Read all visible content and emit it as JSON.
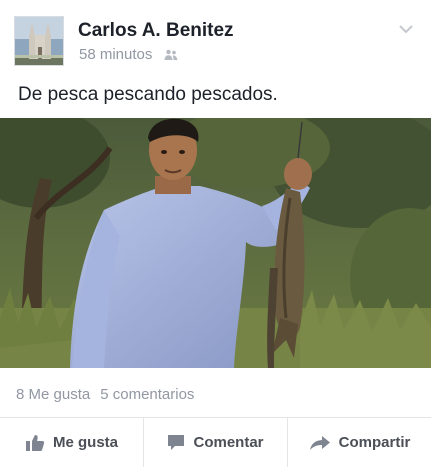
{
  "post": {
    "author": "Carlos A. Benitez",
    "time": "58 minutos",
    "audience_icon": "friends-icon",
    "menu_icon": "chevron-down-icon",
    "text": "De pesca pescando pescados.",
    "photo_description_icon": "photo",
    "likes": "8 Me gusta",
    "comments": "5 comentarios"
  },
  "actions": {
    "like": "Me gusta",
    "comment": "Comentar",
    "share": "Compartir"
  },
  "colors": {
    "text": "#1d2129",
    "muted": "#9197a3",
    "action": "#4b4f56",
    "divider": "#e5e5e5"
  }
}
